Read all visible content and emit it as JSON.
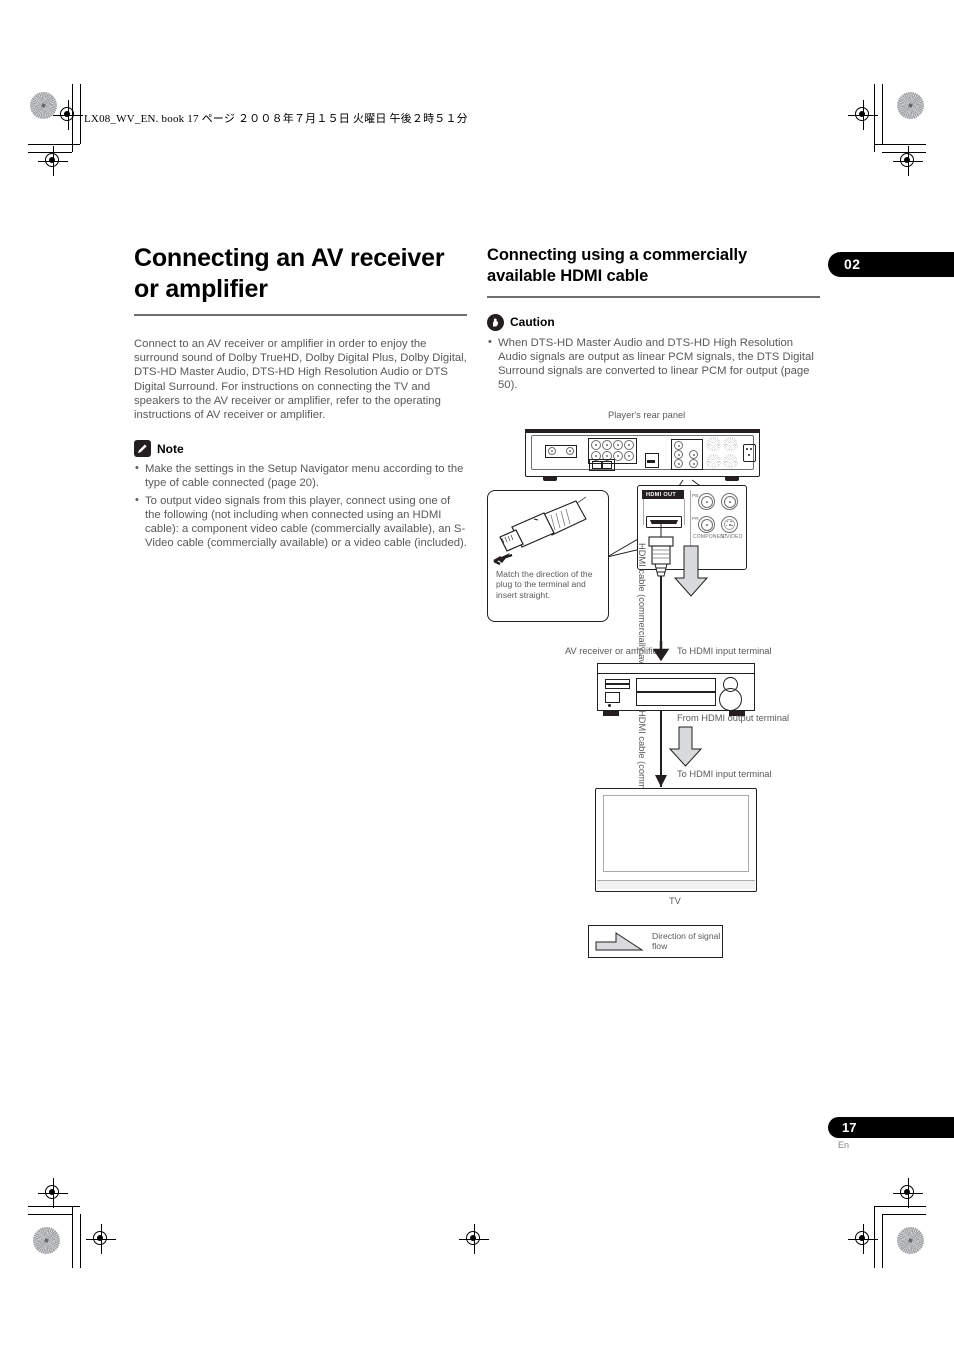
{
  "header": {
    "book_line": "LX08_WV_EN. book   17 ページ   ２００８年７月１５日   火曜日   午後２時５１分"
  },
  "chapter": {
    "number": "02"
  },
  "footer": {
    "page_number": "17",
    "language": "En"
  },
  "left_column": {
    "title": "Connecting an AV receiver or amplifier",
    "intro": "Connect to an AV receiver or amplifier in order to enjoy the surround sound of Dolby TrueHD, Dolby Digital Plus, Dolby Digital, DTS-HD Master Audio, DTS-HD High Resolution Audio or DTS Digital Surround. For instructions on connecting the TV and speakers to the AV receiver or amplifier, refer to the operating instructions of AV receiver or amplifier.",
    "note": {
      "label": "Note",
      "icon": "pencil-icon",
      "items": [
        "Make the settings in the Setup Navigator menu according to the type of cable connected (page 20).",
        "To output video signals from this player, connect using one of the following (not including when connected using an HDMI cable): a component video cable (commercially available), an S-Video cable (commercially available) or a video cable (included)."
      ]
    }
  },
  "right_column": {
    "title": "Connecting using a commercially available HDMI cable",
    "caution": {
      "label": "Caution",
      "icon": "hand-stop-icon",
      "items": [
        "When DTS-HD Master Audio and DTS-HD High Resolution Audio signals are output as linear PCM signals, the DTS Digital Surround signals are converted to linear PCM for output (page 50)."
      ]
    }
  },
  "diagram": {
    "rear_panel_caption": "Player's rear panel",
    "callout_text": "Match the direction of the plug to the terminal and insert straight.",
    "hdmi_out_label": "HDMI OUT",
    "component_label": "COMPONENT",
    "svideo_label": "S VIDEO",
    "pb_label": "PB",
    "pr_label": "PR",
    "cable_label_top": "HDMI cable (commercially available)",
    "receiver_label": "AV receiver or amplifier",
    "to_hdmi_input_top": "To HDMI input terminal",
    "from_hdmi_output": "From HDMI output terminal",
    "cable_label_bottom": "HDMI cable (commercially available)",
    "to_hdmi_input_bottom": "To HDMI input terminal",
    "tv_label": "TV",
    "legend_text": "Direction of signal flow"
  }
}
